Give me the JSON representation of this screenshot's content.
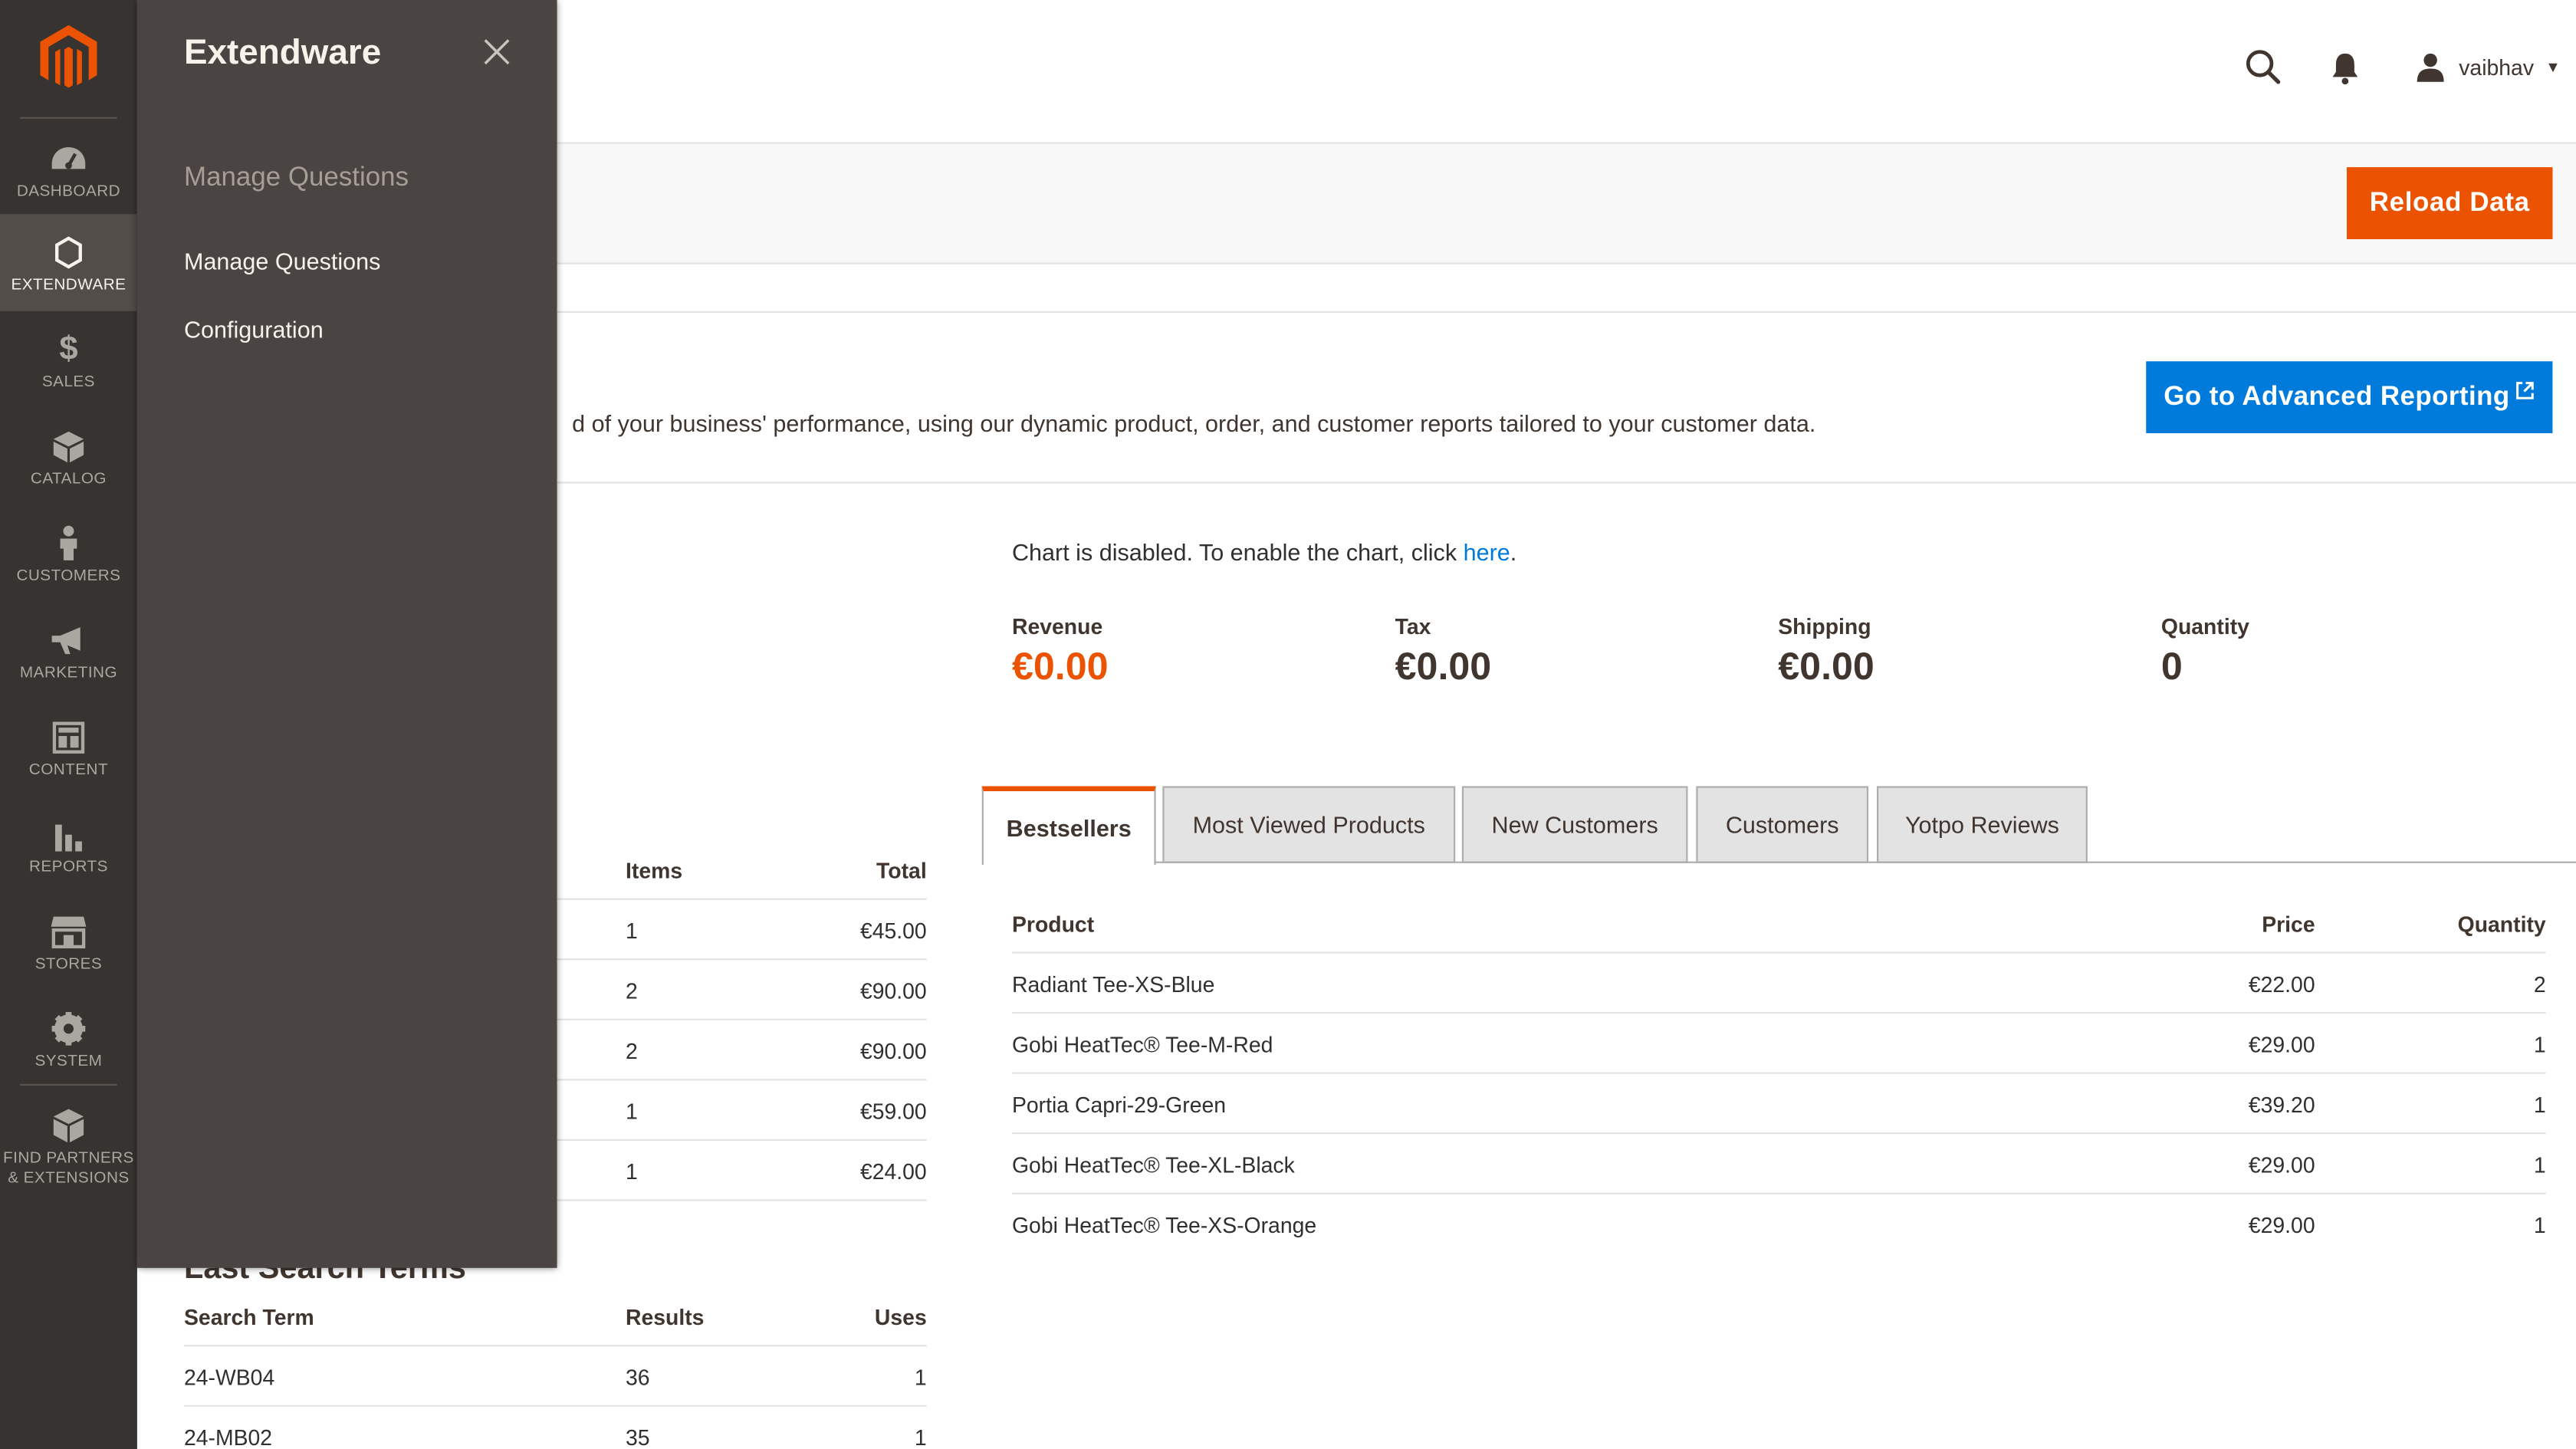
{
  "nav": {
    "items": [
      {
        "key": "dashboard",
        "label": "DASHBOARD",
        "icon": "dashboard-icon"
      },
      {
        "key": "extendware",
        "label": "EXTENDWARE",
        "icon": "hexagon-icon"
      },
      {
        "key": "sales",
        "label": "SALES",
        "icon": "dollar-icon"
      },
      {
        "key": "catalog",
        "label": "CATALOG",
        "icon": "box-icon"
      },
      {
        "key": "customers",
        "label": "CUSTOMERS",
        "icon": "person-icon"
      },
      {
        "key": "marketing",
        "label": "MARKETING",
        "icon": "megaphone-icon"
      },
      {
        "key": "content",
        "label": "CONTENT",
        "icon": "layout-icon"
      },
      {
        "key": "reports",
        "label": "REPORTS",
        "icon": "bar-chart-icon"
      },
      {
        "key": "stores",
        "label": "STORES",
        "icon": "storefront-icon"
      },
      {
        "key": "system",
        "label": "SYSTEM",
        "icon": "gear-icon"
      },
      {
        "key": "partners",
        "label_line1": "FIND PARTNERS",
        "label_line2": "& EXTENSIONS",
        "icon": "cubes-icon"
      }
    ]
  },
  "header": {
    "username": "vaibhav"
  },
  "actions": {
    "reload_label": "Reload Data"
  },
  "advanced": {
    "text": "d of your business' performance, using our dynamic product, order, and customer reports tailored to your customer data.",
    "button_label": "Go to Advanced Reporting"
  },
  "chart": {
    "message": "Chart is disabled. To enable the chart, click ",
    "link": "here",
    "period": "."
  },
  "totals": [
    {
      "label": "Revenue",
      "value": "€0.00"
    },
    {
      "label": "Tax",
      "value": "€0.00"
    },
    {
      "label": "Shipping",
      "value": "€0.00"
    },
    {
      "label": "Quantity",
      "value": "0"
    }
  ],
  "tabs": [
    "Bestsellers",
    "Most Viewed Products",
    "New Customers",
    "Customers",
    "Yotpo Reviews"
  ],
  "bestsellers": {
    "headers": {
      "product": "Product",
      "price": "Price",
      "quantity": "Quantity"
    },
    "rows": [
      {
        "product": "Radiant Tee-XS-Blue",
        "price": "€22.00",
        "quantity": "2"
      },
      {
        "product": "Gobi HeatTec® Tee-M-Red",
        "price": "€29.00",
        "quantity": "1"
      },
      {
        "product": "Portia Capri-29-Green",
        "price": "€39.20",
        "quantity": "1"
      },
      {
        "product": "Gobi HeatTec® Tee-XL-Black",
        "price": "€29.00",
        "quantity": "1"
      },
      {
        "product": "Gobi HeatTec® Tee-XS-Orange",
        "price": "€29.00",
        "quantity": "1"
      }
    ]
  },
  "orders": {
    "headers": {
      "items": "Items",
      "total": "Total"
    },
    "rows": [
      {
        "items": "1",
        "total": "€45.00"
      },
      {
        "items": "2",
        "total": "€90.00"
      },
      {
        "items": "2",
        "total": "€90.00"
      },
      {
        "items": "1",
        "total": "€59.00"
      },
      {
        "items": "1",
        "total": "€24.00"
      }
    ]
  },
  "search_terms": {
    "title": "Last Search Terms",
    "headers": {
      "term": "Search Term",
      "results": "Results",
      "uses": "Uses"
    },
    "rows": [
      {
        "term": "24-WB04",
        "results": "36",
        "uses": "1"
      },
      {
        "term": "24-MB02",
        "results": "35",
        "uses": "1"
      }
    ]
  },
  "flyout": {
    "title": "Extendware",
    "group": "Manage Questions",
    "links": [
      "Manage Questions",
      "Configuration"
    ]
  },
  "colors": {
    "accent": "#eb5202",
    "link": "#007bdb",
    "nav_bg": "#373330",
    "flyout_bg": "#4a4542"
  }
}
